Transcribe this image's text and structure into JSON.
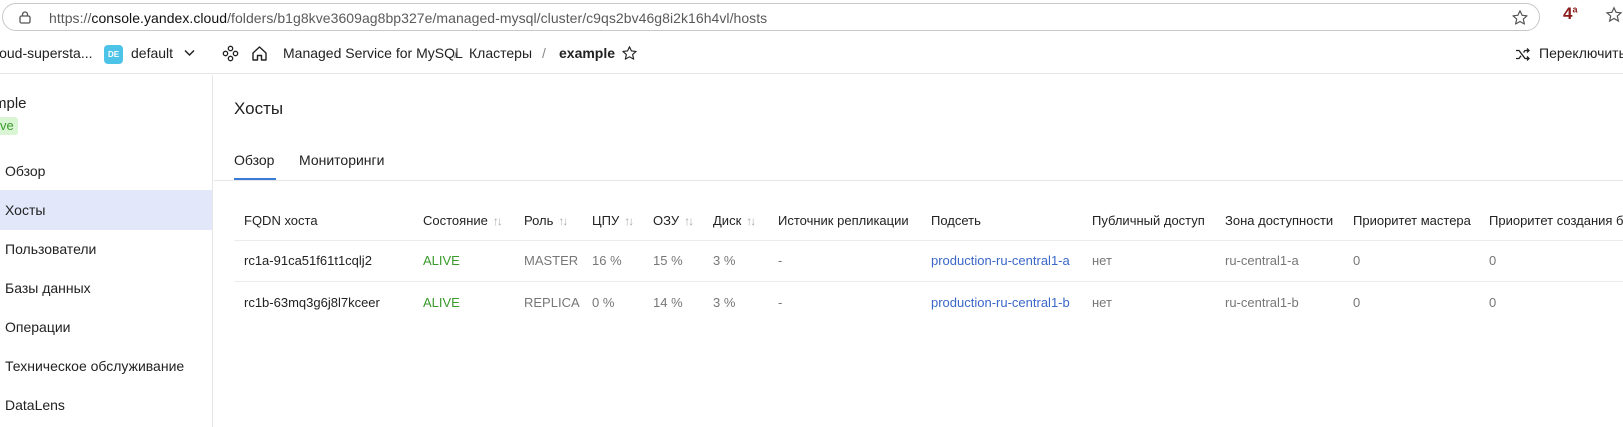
{
  "browser": {
    "url_prefix": "https://",
    "url_domain": "console.yandex.cloud",
    "url_path": "/folders/b1g8kve3609ag8bp327e/managed-mysql/cluster/c9qs2bv46g8i2k16h4vl/hosts",
    "ext_badge": "4",
    "ext_badge_sup": "a"
  },
  "header": {
    "cloud_name": "loud-supersta...",
    "folder_badge": "DE",
    "folder_name": "default",
    "breadcrumbs": [
      "Managed Service for MySQL",
      "Кластеры",
      "example"
    ],
    "switch_label": "Переключить"
  },
  "sidebar": {
    "cluster_name": "mple",
    "status": "ve",
    "items": [
      "Обзор",
      "Хосты",
      "Пользователи",
      "Базы данных",
      "Операции",
      "Техническое обслуживание",
      "DataLens"
    ]
  },
  "main": {
    "title": "Хосты",
    "tabs": [
      "Обзор",
      "Мониторинги"
    ],
    "columns": [
      "FQDN хоста",
      "Состояние",
      "Роль",
      "ЦПУ",
      "ОЗУ",
      "Диск",
      "Источник репликации",
      "Подсеть",
      "Публичный доступ",
      "Зона доступности",
      "Приоритет мастера",
      "Приоритет создания б"
    ],
    "rows": [
      {
        "fqdn": "rc1a-91ca51f61t1cqlj2",
        "state": "ALIVE",
        "role": "MASTER",
        "cpu": "16 %",
        "ram": "15 %",
        "disk": "3 %",
        "source": "-",
        "subnet": "production-ru-central1-a",
        "public": "нет",
        "zone": "ru-central1-a",
        "master_priority": "0",
        "backup_priority": "0"
      },
      {
        "fqdn": "rc1b-63mq3g6j8l7kceer",
        "state": "ALIVE",
        "role": "REPLICA",
        "cpu": "0 %",
        "ram": "14 %",
        "disk": "3 %",
        "source": "-",
        "subnet": "production-ru-central1-b",
        "public": "нет",
        "zone": "ru-central1-b",
        "master_priority": "0",
        "backup_priority": "0"
      }
    ]
  }
}
